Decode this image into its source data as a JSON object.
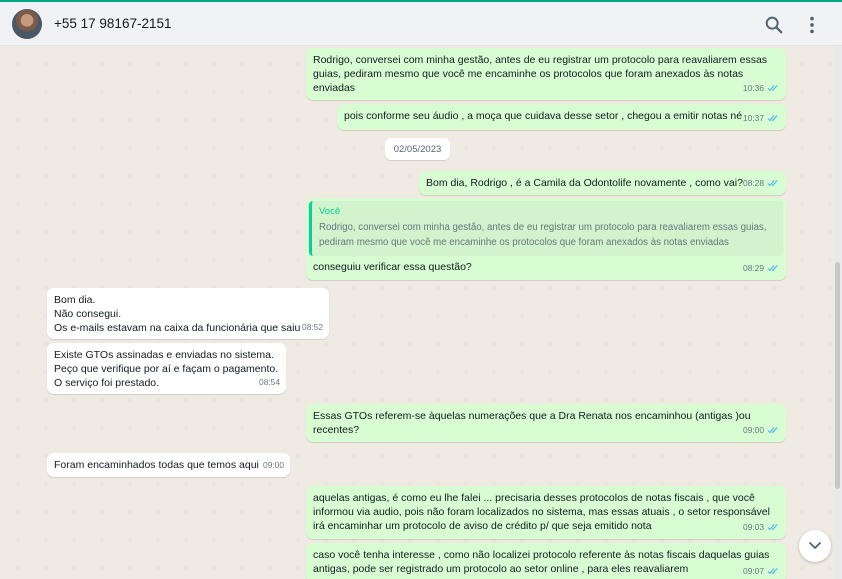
{
  "header": {
    "contact_name": "+55 17 98167-2151",
    "icons": [
      "search-icon",
      "menu-icon"
    ]
  },
  "chat": {
    "date_separator": "02/05/2023",
    "messages": [
      {
        "direction": "out",
        "text": "Rodrigo, conversei com minha gestão, antes de eu registrar um protocolo para reavaliarem essas\nguias, pediram mesmo que você me encaminhe os protocolos que foram anexados às notas\nenviadas",
        "time": "10:36",
        "status": "read"
      },
      {
        "direction": "out",
        "text": "pois conforme seu áudio , a moça que cuidava desse setor , chegou a emitir notas né",
        "time": "10:37",
        "status": "read"
      },
      {
        "direction": "out",
        "text": "Bom dia, Rodrigo , é a Camila da Odontolife novamente , como vai?",
        "time": "08:28",
        "status": "read"
      },
      {
        "direction": "out",
        "quote_author": "Você",
        "quote_text": "Rodrigo, conversei com minha gestão, antes de eu registrar um protocolo para reavaliarem essas guias, pediram mesmo que você me encaminhe os protocolos que foram anexados às notas enviadas",
        "text": "conseguiu verificar essa questão?",
        "time": "08:29",
        "status": "read"
      },
      {
        "direction": "in",
        "text": "Bom dia.\nNão consegui.\nOs e-mails estavam na caixa da funcionária que saiu",
        "time": "08:52"
      },
      {
        "direction": "in",
        "text": "Existe GTOs assinadas e enviadas no sistema.\nPeço que verifique por aí e façam o pagamento.\nO serviço foi prestado.",
        "time": "08:54"
      },
      {
        "direction": "out",
        "text": "Essas GTOs referem-se àquelas numerações que a Dra Renata nos encaminhou (antigas )ou\nrecentes?",
        "time": "09:00",
        "status": "read"
      },
      {
        "direction": "in",
        "text": "Foram encaminhados todas que temos aqui",
        "time": "09:00"
      },
      {
        "direction": "out",
        "text": "aquelas antigas, é como eu lhe falei ... precisaria desses protocolos de notas fiscais , que você\ninformou via audio, pois não foram localizados no sistema,  mas essas atuais , o setor responsável\nirá encaminhar um protocolo de aviso de crédito p/ que seja emitido nota",
        "time": "09:03",
        "status": "read"
      },
      {
        "direction": "out",
        "text": "caso você tenha interesse , como não localizei protocolo referente às notas fiscais daquelas guias\nantigas, pode ser registrado um protocolo ao setor online , para eles reavaliarem",
        "time": "09:07",
        "status": "read"
      }
    ]
  },
  "icons": {
    "read_tick": "double-check-icon",
    "scroll_down": "chevron-down-icon"
  },
  "colors": {
    "outgoing_bubble": "#d9fdd3",
    "incoming_bubble": "#ffffff",
    "chat_background": "#efeae2",
    "header_background": "#f0f2f5",
    "read_tick": "#53bdeb",
    "quote_accent": "#06cf9c"
  }
}
